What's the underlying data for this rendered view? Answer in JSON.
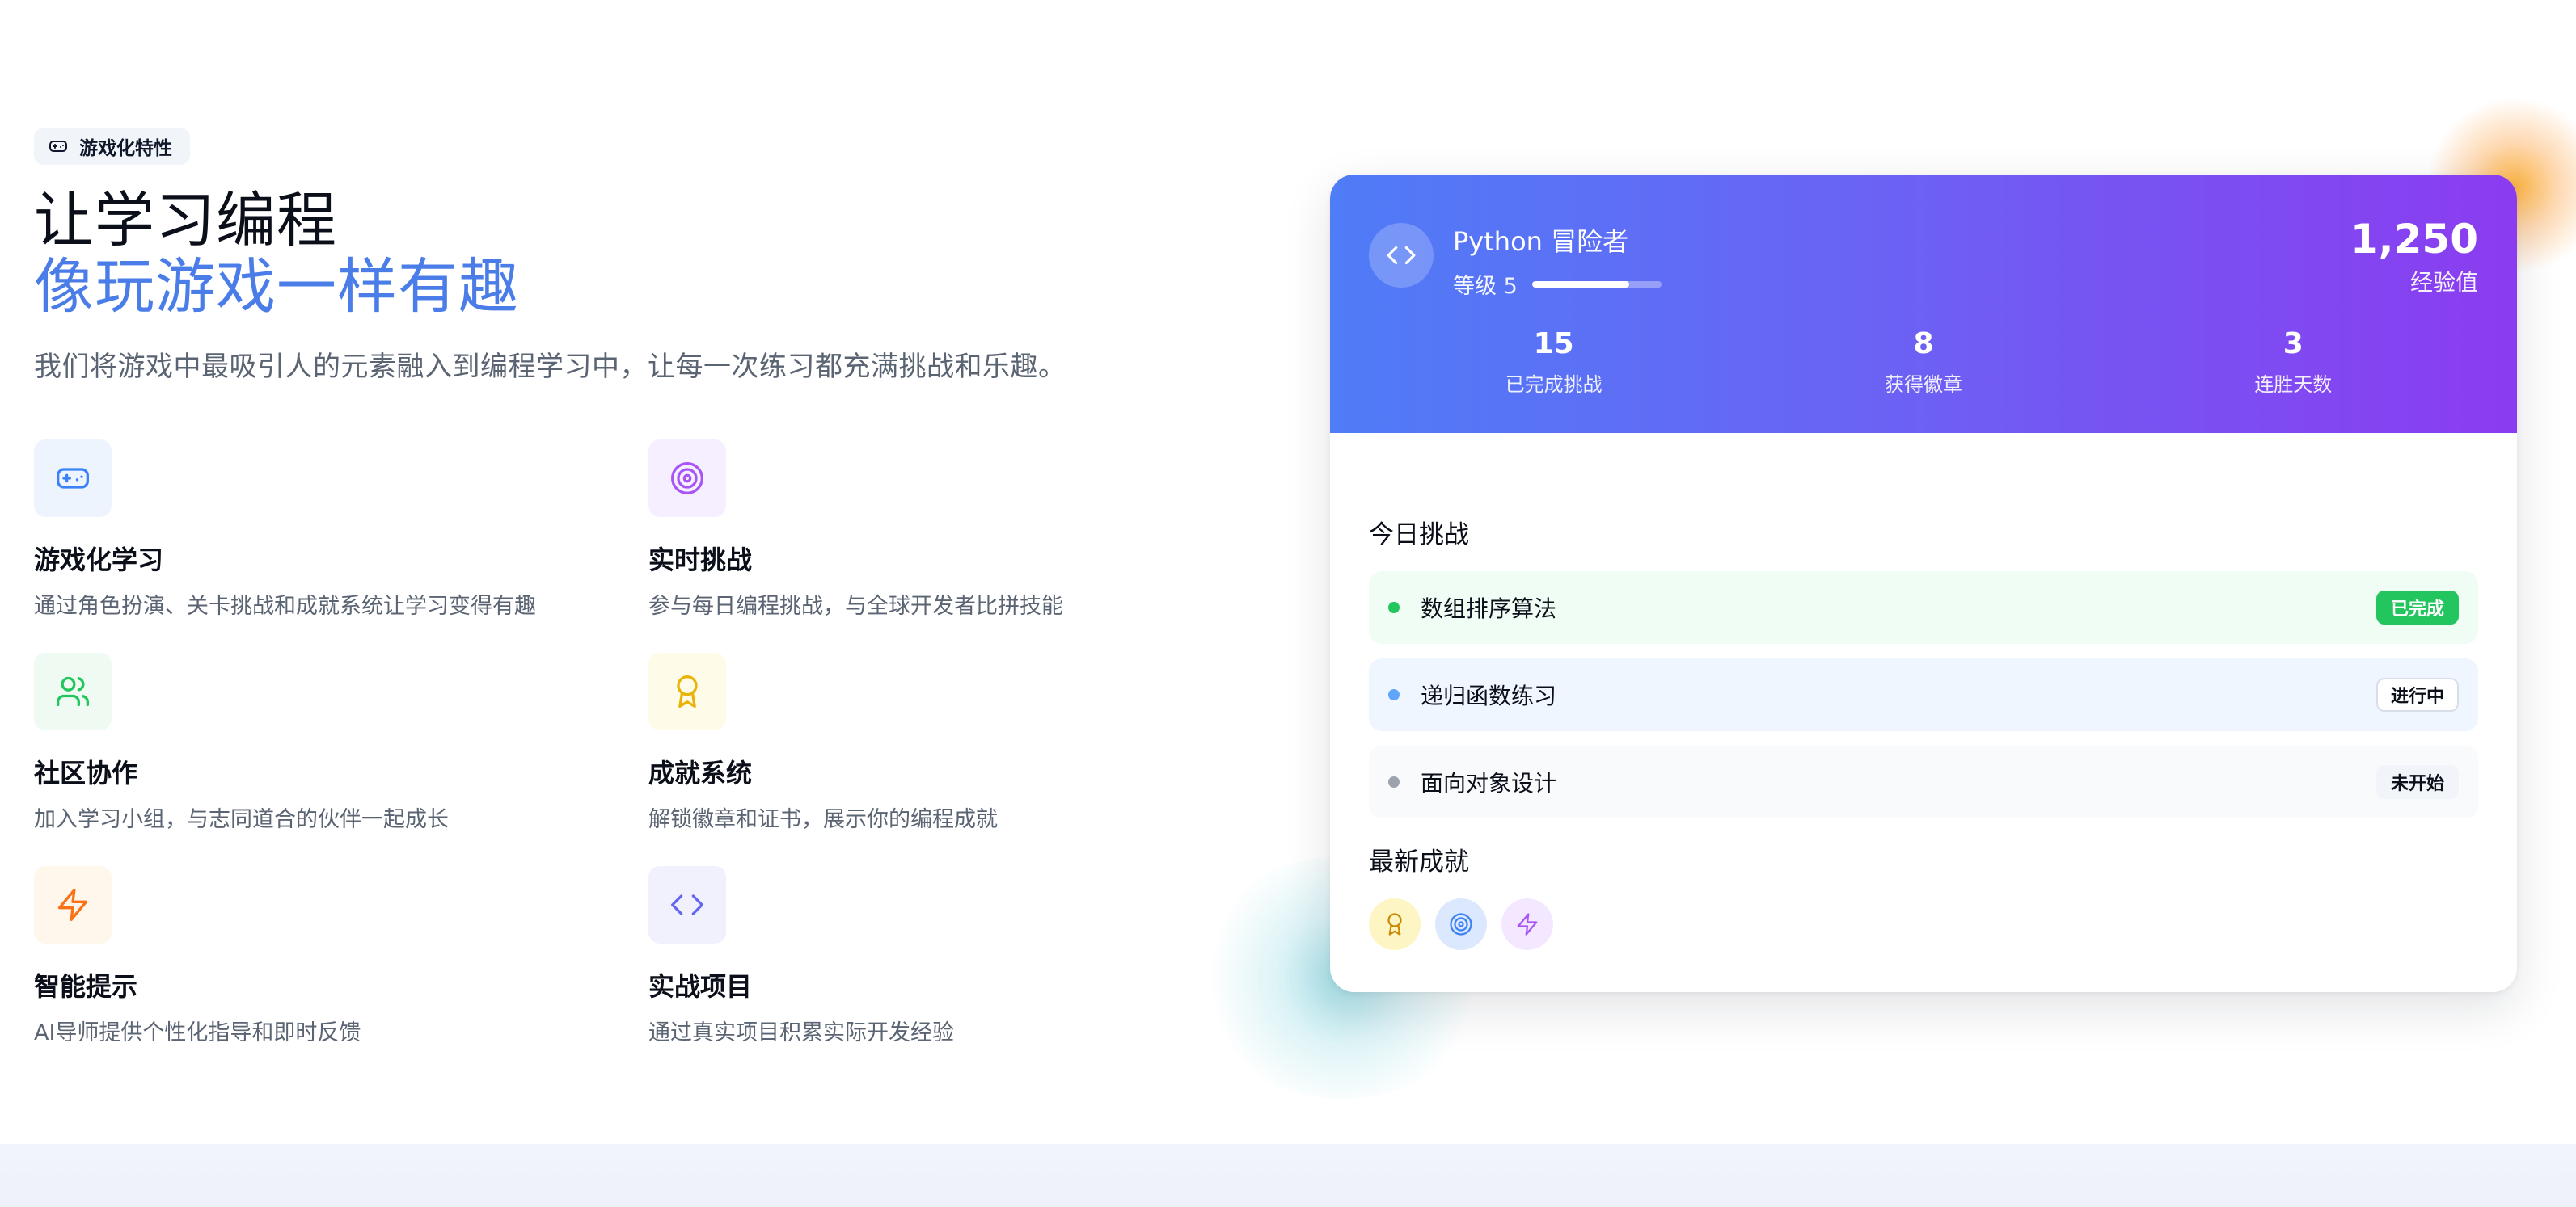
{
  "section_badge": {
    "label": "游戏化特性",
    "icon": "gamepad-icon"
  },
  "headline": {
    "line1": "让学习编程",
    "line2": "像玩游戏一样有趣"
  },
  "subtitle": "我们将游戏中最吸引人的元素融入到编程学习中，让每一次练习都充满挑战和乐趣。",
  "features": [
    {
      "title": "游戏化学习",
      "desc": "通过角色扮演、关卡挑战和成就系统让学习变得有趣",
      "icon": "gamepad-icon",
      "color": "#3b82f6",
      "bg": "#eef4fe"
    },
    {
      "title": "实时挑战",
      "desc": "参与每日编程挑战，与全球开发者比拼技能",
      "icon": "target-icon",
      "color": "#a855f7",
      "bg": "#f6efff"
    },
    {
      "title": "社区协作",
      "desc": "加入学习小组，与志同道合的伙伴一起成长",
      "icon": "users-icon",
      "color": "#22c55e",
      "bg": "#effbf2"
    },
    {
      "title": "成就系统",
      "desc": "解锁徽章和证书，展示你的编程成就",
      "icon": "award-icon",
      "color": "#eab308",
      "bg": "#fefbe8"
    },
    {
      "title": "智能提示",
      "desc": "AI导师提供个性化指导和即时反馈",
      "icon": "zap-icon",
      "color": "#f97316",
      "bg": "#fff6ec"
    },
    {
      "title": "实战项目",
      "desc": "通过真实项目积累实际开发经验",
      "icon": "code-icon",
      "color": "#6366f1",
      "bg": "#f1f1fe"
    }
  ],
  "card": {
    "player_name": "Python 冒险者",
    "level_label": "等级 5",
    "level_progress": 0.75,
    "xp_value": "1,250",
    "xp_label": "经验值",
    "stats": [
      {
        "value": "15",
        "label": "已完成挑战"
      },
      {
        "value": "8",
        "label": "获得徽章"
      },
      {
        "value": "3",
        "label": "连胜天数"
      }
    ],
    "today_title": "今日挑战",
    "challenges": [
      {
        "name": "数组排序算法",
        "status": "已完成",
        "dot": "#22c55e",
        "bg": "#f0fdf4",
        "status_bg": "#22c55e",
        "status_color": "#ffffff",
        "status_border": "#22c55e"
      },
      {
        "name": "递归函数练习",
        "status": "进行中",
        "dot": "#60a5fa",
        "bg": "#eff6ff",
        "status_bg": "#ffffff",
        "status_color": "#0b0f19",
        "status_border": "#d8dee8"
      },
      {
        "name": "面向对象设计",
        "status": "未开始",
        "dot": "#9ca3af",
        "bg": "#f8fafc",
        "status_bg": "#f1f5f9",
        "status_color": "#0b0f19",
        "status_border": "#f1f5f9"
      }
    ],
    "achievements_title": "最新成就",
    "achievements": [
      {
        "icon": "award-icon",
        "color": "#ca8a04",
        "bg": "#fdf6c4"
      },
      {
        "icon": "target-icon",
        "color": "#3b82f6",
        "bg": "#dbe8fd"
      },
      {
        "icon": "zap-icon",
        "color": "#a855f7",
        "bg": "#f3e8ff"
      }
    ]
  }
}
